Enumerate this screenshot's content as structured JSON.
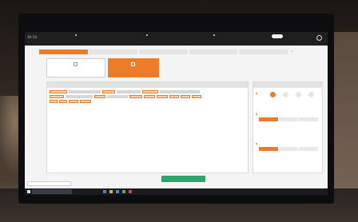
{
  "app": {
    "clock": "19:53",
    "steps": [
      {
        "label": ""
      },
      {
        "label": ""
      },
      {
        "label": ""
      }
    ],
    "header_right_text": ""
  },
  "tabs": [
    {
      "label": "",
      "active": true
    },
    {
      "label": "",
      "active": false
    },
    {
      "label": "",
      "active": false
    },
    {
      "label": "",
      "active": false
    },
    {
      "label": "",
      "active": false
    }
  ],
  "top_right_text": "",
  "modes": [
    {
      "label": "",
      "selected": false
    },
    {
      "label": "",
      "selected": true
    }
  ],
  "main_panel": {
    "title": "",
    "header_button": ""
  },
  "side_panel": {
    "title": "",
    "rows": [
      {
        "label": ""
      },
      {
        "label": ""
      },
      {
        "label": ""
      }
    ]
  },
  "bottom": {
    "left_label": "",
    "input_value": "",
    "primary_button": ""
  },
  "taskbar": {
    "tray_text": ""
  },
  "colors": {
    "accent": "#ee7b27",
    "primary_action": "#2ea46b",
    "header_bg": "#1f1f1f",
    "app_bg": "#f4f4f4"
  }
}
